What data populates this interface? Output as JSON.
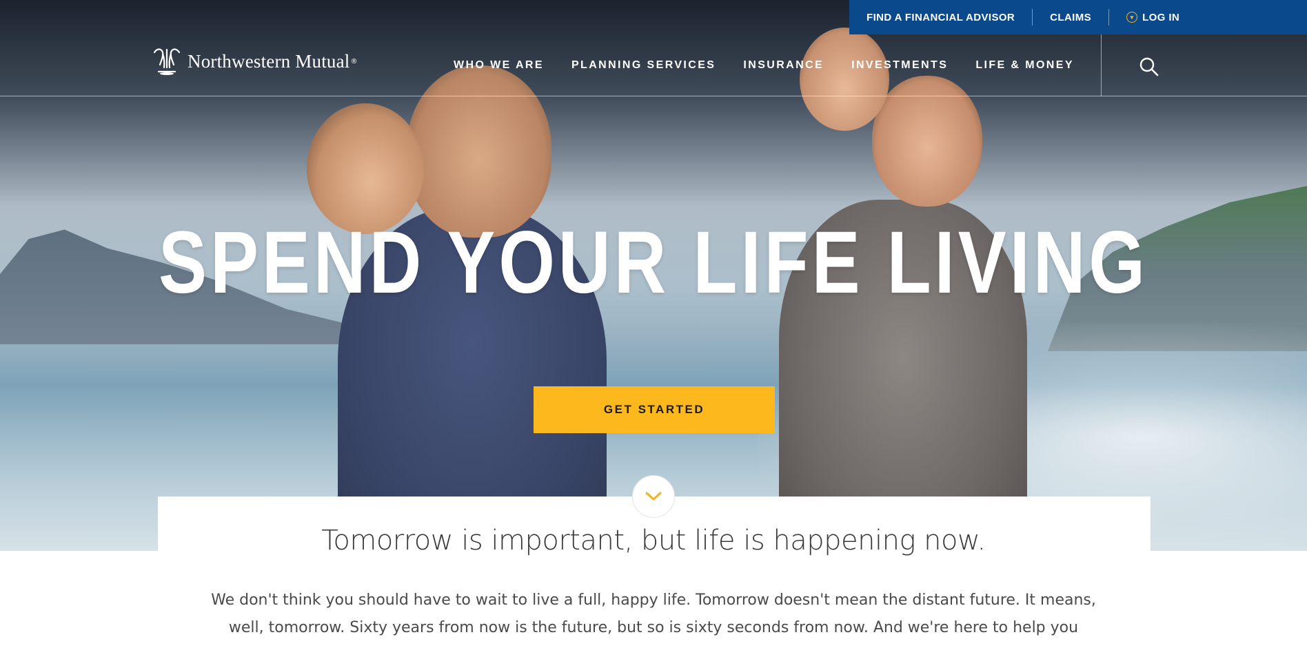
{
  "utility_bar": {
    "find_advisor": "FIND A FINANCIAL ADVISOR",
    "claims": "CLAIMS",
    "login": "LOG IN"
  },
  "brand": {
    "name": "Northwestern Mutual",
    "registered": "®"
  },
  "nav": {
    "items": [
      {
        "label": "WHO WE ARE"
      },
      {
        "label": "PLANNING SERVICES"
      },
      {
        "label": "INSURANCE"
      },
      {
        "label": "INVESTMENTS"
      },
      {
        "label": "LIFE & MONEY"
      }
    ],
    "search_icon": "search-icon"
  },
  "hero": {
    "headline": "SPEND YOUR LIFE LIVING",
    "cta_label": "GET STARTED",
    "scroll_icon": "chevron-down-icon"
  },
  "content": {
    "subheadline": "Tomorrow is important, but life is happening now.",
    "body": "We don't think you should have to wait to live a full, happy life. Tomorrow doesn't mean the distant future. It means, well, tomorrow. Sixty years from now is the future, but so is sixty seconds from now. And we're here to help you make"
  },
  "colors": {
    "utility_bar_bg": "#0a4a8c",
    "cta_bg": "#fdb81e",
    "accent_gold": "#f4b221"
  }
}
